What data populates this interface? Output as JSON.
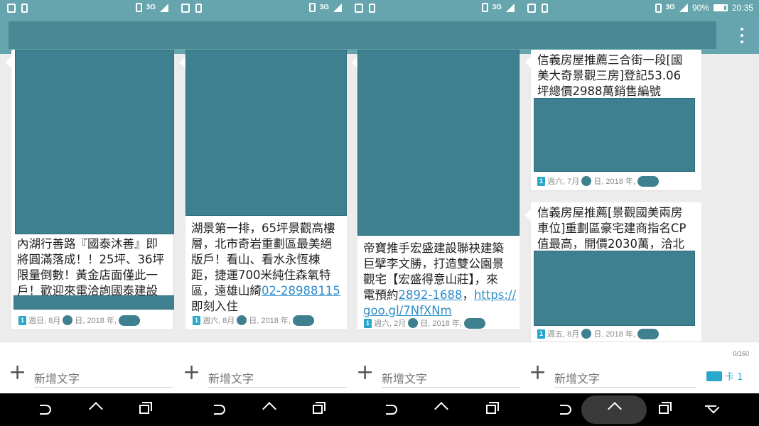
{
  "status": {
    "battery": "90%",
    "time": "20:35",
    "network": "3G"
  },
  "compose": {
    "placeholder": "新增文字",
    "counter": "0/160",
    "sim_label": "卡 1"
  },
  "panels": [
    {
      "message": {
        "lines": [
          "內湖行善路『國泰沐善』即",
          "將圓滿落成！！25坪、36坪",
          "限量倒數！黃金店面僅此一",
          "戶！歡迎來電洽詢國泰建設"
        ],
        "sim": "1",
        "meta": {
          "weekday": "週日, 8月",
          "day": "日, 2018 年,"
        }
      }
    },
    {
      "message": {
        "lines": [
          "湖景第一排，65坪景觀高樓",
          "層，北市奇岩重劃區最美絕",
          "版戶！看山、看水永恆棟",
          "距，捷運700米純住森氧特",
          "區，遠雄山綺"
        ],
        "phone": "02-28988115",
        "tail": "即刻入住",
        "sim": "1",
        "meta": {
          "weekday": "週六, 8月",
          "day": "日, 2018 年,"
        }
      }
    },
    {
      "message": {
        "lines": [
          "帝寶推手宏盛建設聯袂建築",
          "巨擘李文勝，打造雙公園景",
          "觀宅【宏盛得意山莊】，來",
          "電預約"
        ],
        "phone": "2892-1688",
        "sep": "，",
        "url1": "https://",
        "url2": "goo.gl/7NfXNm",
        "sim": "1",
        "meta": {
          "weekday": "週六, 2月",
          "day": "日, 2018 年,"
        }
      }
    },
    {
      "messages": [
        {
          "lines": [
            "信義房屋推薦三合街一段[國",
            "美大奇景觀三房]登記53.06",
            "坪總價2988萬銷售編號"
          ],
          "sim": "1",
          "meta": {
            "weekday": "週六, 7月",
            "day": "日, 2018 年,"
          }
        },
        {
          "lines": [
            "信義房屋推薦[景觀國美兩房",
            "車位]重劃區豪宅建商指名CP",
            "值最高，開價2030萬，洽北"
          ],
          "sim": "1",
          "meta": {
            "weekday": "週五, 8月",
            "day": "日, 2018 年,"
          }
        }
      ]
    }
  ]
}
